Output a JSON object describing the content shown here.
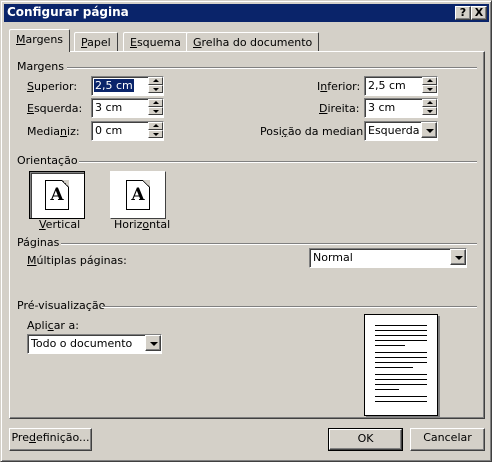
{
  "window": {
    "title": "Configurar página",
    "help_btn": "?",
    "close_btn": "X"
  },
  "tabs": [
    {
      "pre": "",
      "key": "M",
      "post": "argens"
    },
    {
      "pre": "",
      "key": "P",
      "post": "apel"
    },
    {
      "pre": "",
      "key": "E",
      "post": "squema"
    },
    {
      "pre": "",
      "key": "G",
      "post": "relha do documento"
    }
  ],
  "margins": {
    "group_label": "Margens",
    "superior": {
      "key": "S",
      "post": "uperior:",
      "value": "2,5 cm"
    },
    "esquerda": {
      "key": "E",
      "post": "squerda:",
      "value": "3 cm"
    },
    "medianiz": {
      "pre": "Media",
      "key": "n",
      "post": "iz:",
      "value": "0 cm"
    },
    "inferior": {
      "pre": "I",
      "key": "n",
      "post": "ferior:",
      "value": "2,5 cm"
    },
    "direita": {
      "key": "D",
      "post": "ireita:",
      "value": "3 cm"
    },
    "posicao": {
      "pre": "Posi",
      "key": "ç",
      "post": "ão da medianiz:",
      "value": "Esquerda"
    }
  },
  "orientation": {
    "group_label": "Orientação",
    "icon_letter": "A",
    "vertical": {
      "key": "V",
      "post": "ertical"
    },
    "horizontal": {
      "pre": "Horiz",
      "key": "o",
      "post": "ntal"
    }
  },
  "pages": {
    "group_label": "Páginas",
    "multiple": {
      "key": "M",
      "post": "últiplas páginas:",
      "value": "Normal"
    }
  },
  "preview": {
    "group_label": "Pré-visualização",
    "apply": {
      "pre": "Apli",
      "key": "c",
      "post": "ar a:",
      "value": "Todo o documento"
    }
  },
  "buttons": {
    "default": {
      "pre": "Pre",
      "key": "d",
      "post": "efinição..."
    },
    "ok": "OK",
    "cancel": "Cancelar"
  }
}
